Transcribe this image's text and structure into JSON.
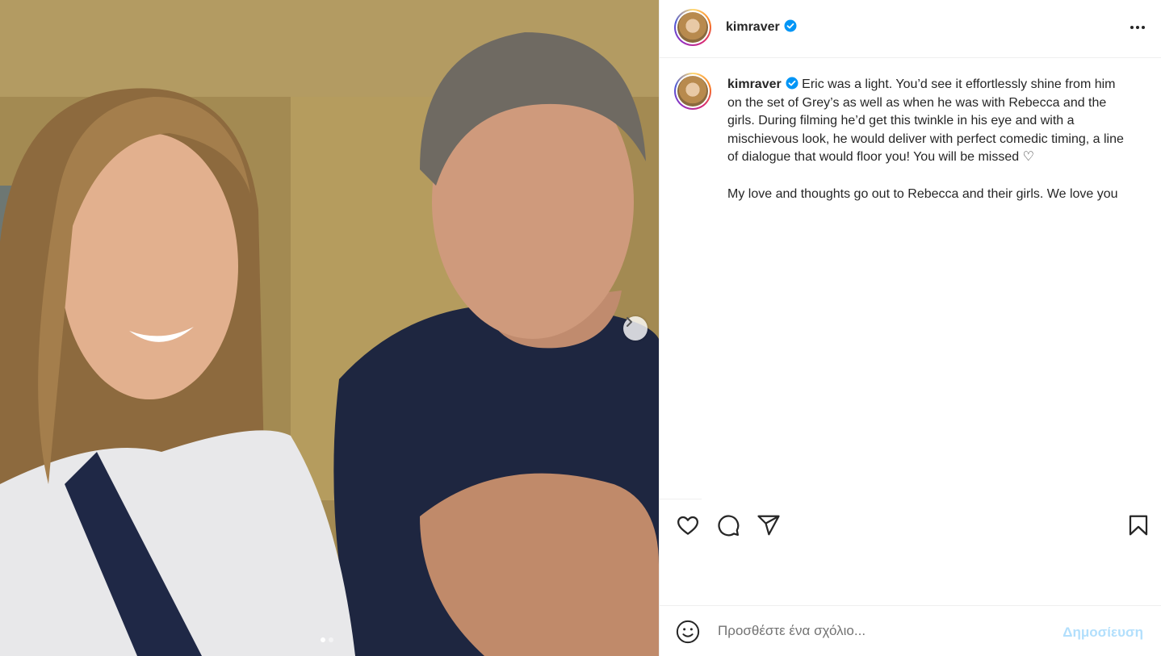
{
  "post": {
    "username": "kimraver",
    "verified": true,
    "caption_p1": "Eric was a light. You’d see it effortlessly shine from him on the set of Grey’s as well as when he was with Rebecca and the girls. During filming he’d get this twinkle in his eye and with a mischievous look, he would deliver with perfect comedic timing, a line of dialogue that would floor you! You will be missed ♡",
    "caption_p2": "My love and thoughts go out to Rebecca and their girls. We love you"
  },
  "carousel": {
    "slides": 2,
    "current": 1
  },
  "comment": {
    "placeholder": "Προσθέστε ένα σχόλιο...",
    "post_label": "Δημοσίευση"
  },
  "colors": {
    "accent": "#0095f6",
    "post_disabled": "#b2dffc",
    "verified": "#0095f6"
  },
  "icons": [
    "more-icon",
    "heart-icon",
    "comment-icon",
    "share-icon",
    "bookmark-icon",
    "emoji-icon",
    "chevron-right-icon",
    "verified-badge-icon"
  ]
}
